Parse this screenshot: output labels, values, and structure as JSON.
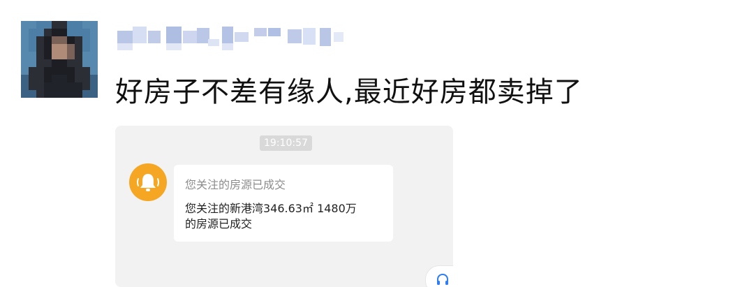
{
  "post": {
    "text": "好房子不差有缘人,最近好房都卖掉了"
  },
  "screenshot": {
    "timestamp": "19:10:57",
    "notification": {
      "icon": "bell-icon",
      "accent_color": "#f5a623",
      "title": "您关注的房源已成交",
      "body_line1": "您关注的新港湾346.63㎡ 1480万",
      "body_line2": "的房源已成交"
    },
    "support_icon": "headset-icon"
  }
}
